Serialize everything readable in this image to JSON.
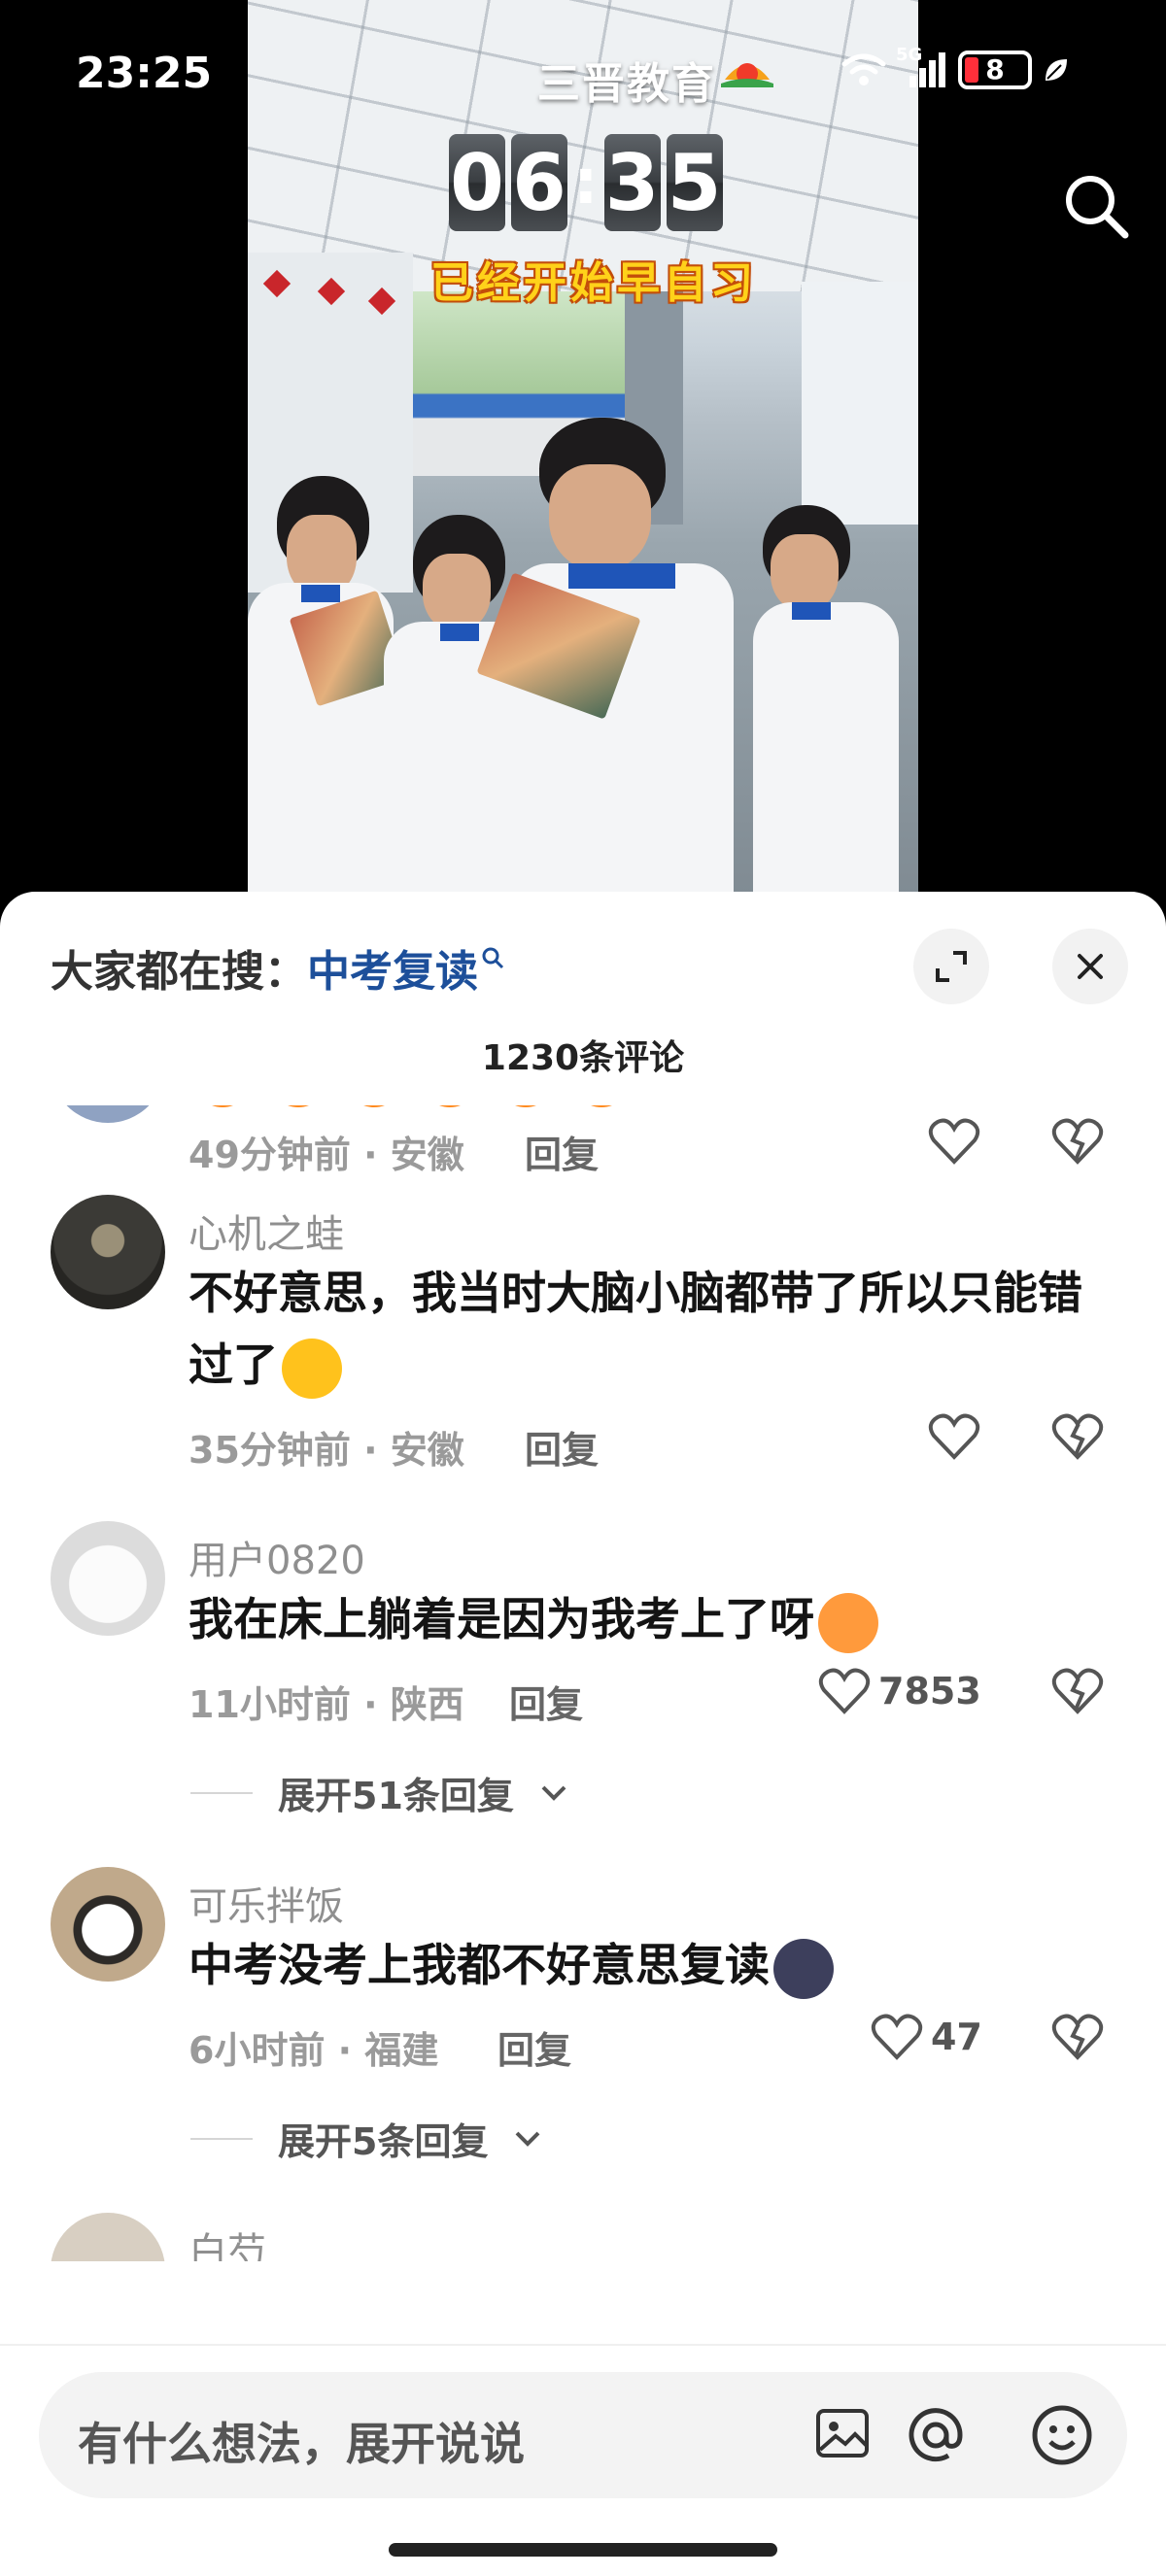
{
  "status_bar": {
    "time": "23:25",
    "network": "5G",
    "battery_level": "8"
  },
  "video": {
    "brand_name": "三晋教育",
    "clock_digits": [
      "0",
      "6",
      "3",
      "5"
    ],
    "caption": "已经开始早自习"
  },
  "comments_panel": {
    "hot_search_label": "大家都在搜：",
    "hot_search_keyword": "中考复读",
    "count_label": "1230条评论",
    "comments": [
      {
        "meta": "49分钟前 · 安徽",
        "reply": "回复"
      },
      {
        "username": "心机之蛙",
        "text": "不好意思，我当时大脑小脑都带了所以只能错过了",
        "meta": "35分钟前 · 安徽",
        "reply": "回复"
      },
      {
        "username": "用户0820",
        "text": "我在床上躺着是因为我考上了呀",
        "meta": "11小时前 · 陕西",
        "reply": "回复",
        "likes": "7853",
        "expand": "展开51条回复"
      },
      {
        "username": "可乐拌饭",
        "text": "中考没考上我都不好意思复读",
        "meta": "6小时前 · 福建",
        "reply": "回复",
        "likes": "47",
        "expand": "展开5条回复"
      },
      {
        "username": "白芍"
      }
    ],
    "input_placeholder": "有什么想法，展开说说"
  },
  "colors": {
    "keyword": "#1d4f9a",
    "battery_low": "#ff2f3a",
    "caption": "#ffd21a"
  }
}
